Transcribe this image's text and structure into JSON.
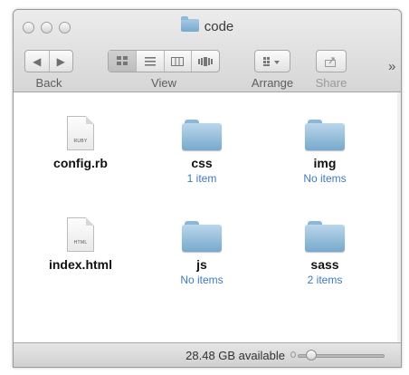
{
  "window": {
    "title": "code"
  },
  "toolbar": {
    "back_label": "Back",
    "view_label": "View",
    "arrange_label": "Arrange",
    "share_label": "Share",
    "more_glyph": "»",
    "back_glyph": "◀",
    "forward_glyph": "▶"
  },
  "items": [
    {
      "name": "config.rb",
      "sub": "",
      "type": "file",
      "tag": "RUBY"
    },
    {
      "name": "css",
      "sub": "1 item",
      "type": "folder"
    },
    {
      "name": "img",
      "sub": "No items",
      "type": "folder"
    },
    {
      "name": "index.html",
      "sub": "",
      "type": "file",
      "tag": "HTML"
    },
    {
      "name": "js",
      "sub": "No items",
      "type": "folder"
    },
    {
      "name": "sass",
      "sub": "2 items",
      "type": "folder"
    }
  ],
  "status": {
    "available": "28.48 GB available",
    "icon_size_level": 0.12
  },
  "colors": {
    "accent": "#3d7ac0",
    "folder": "#8db7d6"
  }
}
